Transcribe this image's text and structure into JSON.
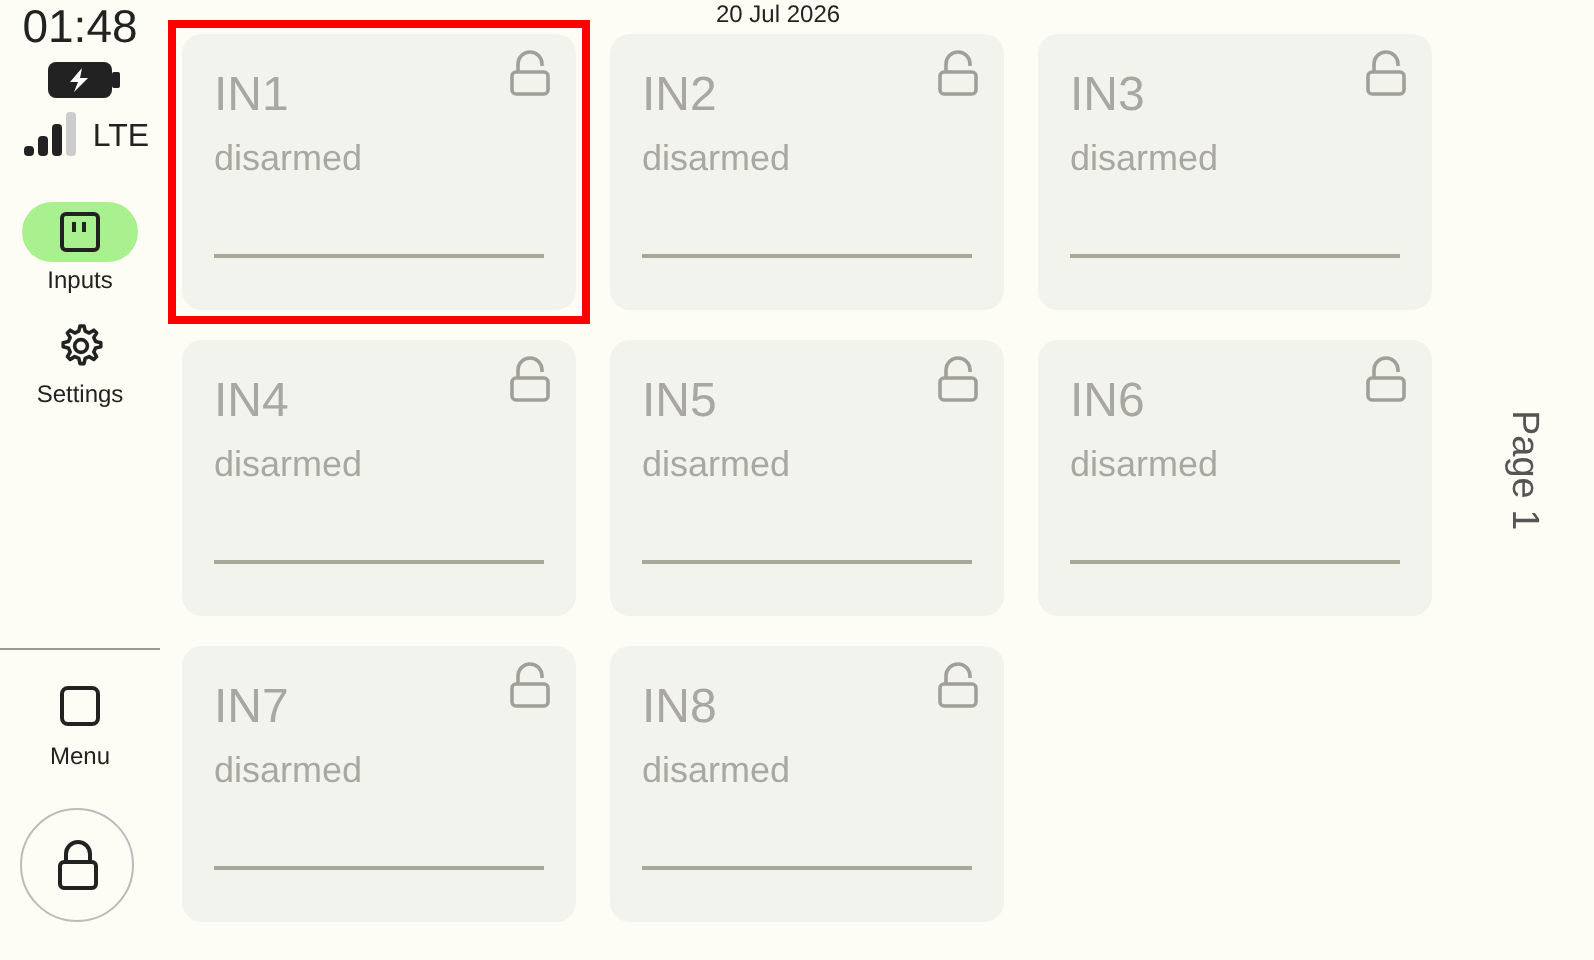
{
  "status": {
    "time": "01:48",
    "network": "LTE",
    "date": "20 Jul 2026"
  },
  "nav": [
    {
      "label": "Inputs",
      "kind": "inputs",
      "selected": true
    },
    {
      "label": "Settings",
      "kind": "settings",
      "selected": false
    }
  ],
  "menu": {
    "label": "Menu"
  },
  "inputs": [
    {
      "name": "IN1",
      "state": "disarmed",
      "locked": false,
      "selected": true
    },
    {
      "name": "IN2",
      "state": "disarmed",
      "locked": false,
      "selected": false
    },
    {
      "name": "IN3",
      "state": "disarmed",
      "locked": false,
      "selected": false
    },
    {
      "name": "IN4",
      "state": "disarmed",
      "locked": false,
      "selected": false
    },
    {
      "name": "IN5",
      "state": "disarmed",
      "locked": false,
      "selected": false
    },
    {
      "name": "IN6",
      "state": "disarmed",
      "locked": false,
      "selected": false
    },
    {
      "name": "IN7",
      "state": "disarmed",
      "locked": false,
      "selected": false
    },
    {
      "name": "IN8",
      "state": "disarmed",
      "locked": false,
      "selected": false
    }
  ],
  "page": "Page 1"
}
